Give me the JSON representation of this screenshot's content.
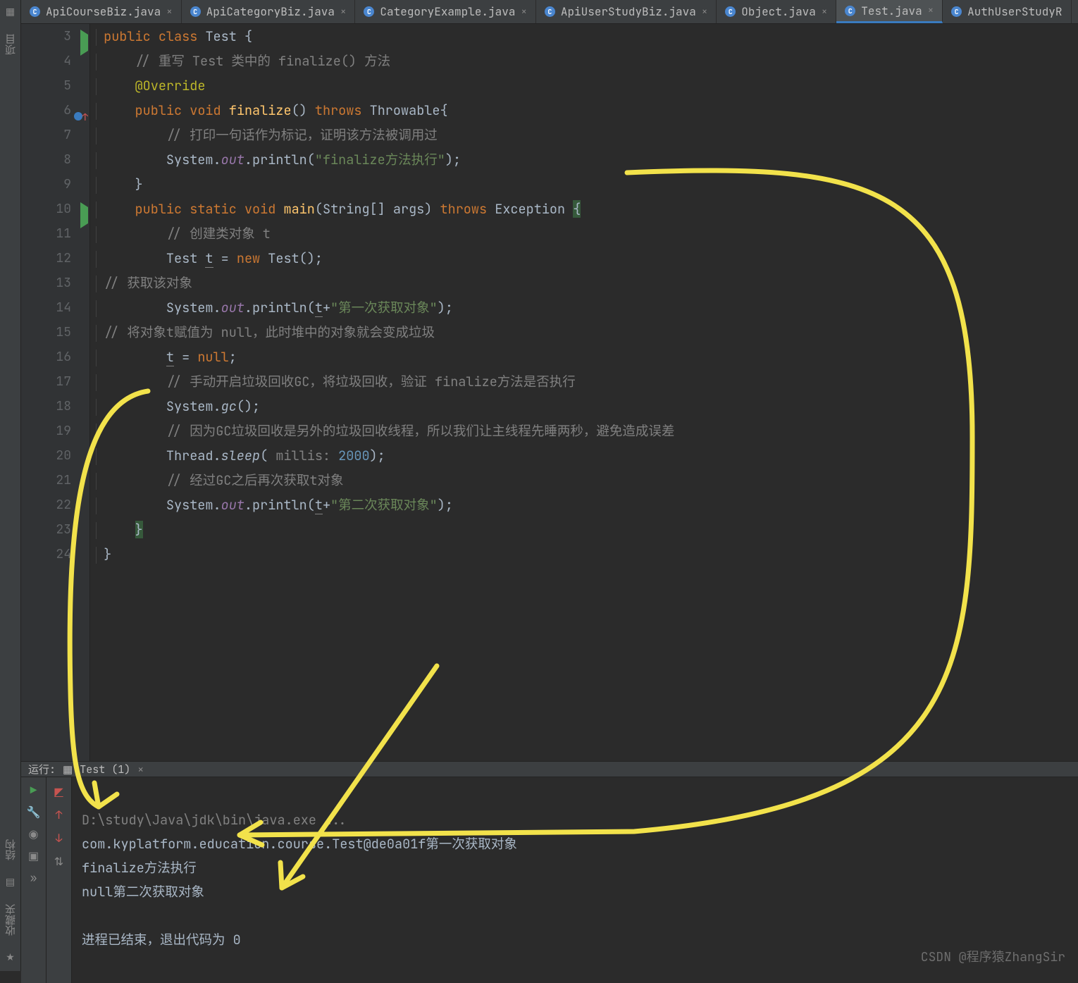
{
  "tabs": [
    {
      "label": "ApiCourseBiz.java"
    },
    {
      "label": "ApiCategoryBiz.java"
    },
    {
      "label": "CategoryExample.java"
    },
    {
      "label": "ApiUserStudyBiz.java"
    },
    {
      "label": "Object.java"
    },
    {
      "label": "Test.java",
      "active": true
    },
    {
      "label": "AuthUserStudyR"
    }
  ],
  "lines": [
    "3",
    "4",
    "5",
    "6",
    "7",
    "8",
    "9",
    "10",
    "11",
    "12",
    "13",
    "14",
    "15",
    "16",
    "17",
    "18",
    "19",
    "20",
    "21",
    "22",
    "23",
    "24"
  ],
  "code": {
    "l3_public": "public",
    "l3_class": "class",
    "l3_name": "Test",
    "l3_br": "{",
    "l4": "// 重写 Test 类中的 finalize() 方法",
    "l5": "@Override",
    "l6_public": "public",
    "l6_void": "void",
    "l6_fin": "finalize",
    "l6_thr": "throws",
    "l6_thrw": "Throwable",
    "l6_br": "{",
    "l7": "// 打印一句话作为标记，证明该方法被调用过",
    "l8_sys": "System.",
    "l8_out": "out",
    "l8_pr": ".println(",
    "l8_str": "\"finalize方法执行\"",
    "l8_end": ");",
    "l9": "}",
    "l10_public": "public",
    "l10_static": "static",
    "l10_void": "void",
    "l10_main": "main",
    "l10_args": "(String[] args)",
    "l10_thr": "throws",
    "l10_exc": "Exception",
    "l10_br": "{",
    "l11": "// 创建类对象 t",
    "l12_a": "Test ",
    "l12_t": "t",
    "l12_b": " = ",
    "l12_new": "new",
    "l12_c": " Test();",
    "l13": "// 获取该对象",
    "l14_sys": "System.",
    "l14_out": "out",
    "l14_pr": ".println(",
    "l14_t": "t",
    "l14_plus": "+",
    "l14_str": "\"第一次获取对象\"",
    "l14_end": ");",
    "l15_a": "// 将对象t赋值为 ",
    "l15_null": "null",
    "l15_b": "，此时堆中的对象就会变成垃圾",
    "l16_t": "t",
    "l16_eq": " = ",
    "l16_null": "null",
    "l16_sc": ";",
    "l17": "// 手动开启垃圾回收GC，将垃圾回收，验证 finalize方法是否执行",
    "l18_sys": "System.",
    "l18_gc": "gc",
    "l18_end": "();",
    "l19": "// 因为GC垃圾回收是另外的垃圾回收线程，所以我们让主线程先睡两秒，避免造成误差",
    "l20_thr": "Thread.",
    "l20_sleep": "sleep",
    "l20_hint": " millis: ",
    "l20_num": "2000",
    "l20_end": ");",
    "l20_lp": "(",
    "l21": "// 经过GC之后再次获取t对象",
    "l22_sys": "System.",
    "l22_out": "out",
    "l22_pr": ".println(",
    "l22_t": "t",
    "l22_plus": "+",
    "l22_str": "\"第二次获取对象\"",
    "l22_end": ");",
    "l23": "}",
    "l24": "}"
  },
  "run": {
    "label": "运行:",
    "tab": "Test (1)",
    "c1": "D:\\study\\Java\\jdk\\bin\\java.exe ...",
    "c2": "com.kyplatform.education.course.Test@de0a01f第一次获取对象",
    "c3": "finalize方法执行",
    "c4": "null第二次获取对象",
    "c5": "进程已结束，退出代码为 0"
  },
  "sidebar": {
    "proj": "项目",
    "struct": "结构",
    "fav": "收藏夹"
  },
  "watermark": "CSDN @程序猿ZhangSir"
}
